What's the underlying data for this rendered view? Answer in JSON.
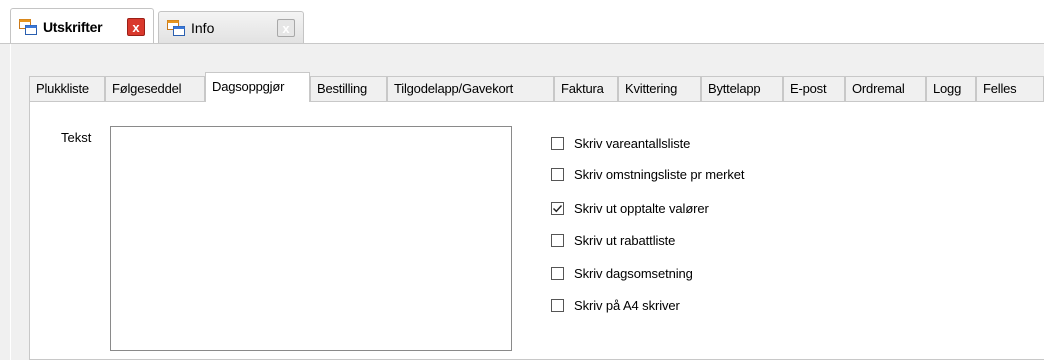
{
  "doc_tabs": [
    {
      "label": "Utskrifter",
      "active": true,
      "close": "x"
    },
    {
      "label": "Info",
      "active": false,
      "close": "x"
    }
  ],
  "tabs": [
    {
      "label": "Plukkliste",
      "active": false
    },
    {
      "label": "Følgeseddel",
      "active": false
    },
    {
      "label": "Dagsoppgjør",
      "active": true
    },
    {
      "label": "Bestilling",
      "active": false
    },
    {
      "label": "Tilgodelapp/Gavekort",
      "active": false
    },
    {
      "label": "Faktura",
      "active": false
    },
    {
      "label": "Kvittering",
      "active": false
    },
    {
      "label": "Byttelapp",
      "active": false
    },
    {
      "label": "E-post",
      "active": false
    },
    {
      "label": "Ordremal",
      "active": false
    },
    {
      "label": "Logg",
      "active": false
    },
    {
      "label": "Felles",
      "active": false
    }
  ],
  "form": {
    "tekst_label": "Tekst",
    "tekst_value": ""
  },
  "checkboxes": [
    {
      "label": "Skriv vareantallsliste",
      "checked": false
    },
    {
      "label": "Skriv omstningsliste pr merket",
      "checked": false
    },
    {
      "label": "Skriv ut opptalte valører",
      "checked": true
    },
    {
      "label": "Skriv ut rabattliste",
      "checked": false
    },
    {
      "label": "Skriv dagsomsetning",
      "checked": false
    },
    {
      "label": "Skriv på A4 skriver",
      "checked": false
    }
  ],
  "icons": {
    "app_icon": "window-app-icon",
    "close_icon": "close-icon",
    "check_icon": "checkmark-icon"
  },
  "colors": {
    "close_active": "#d9382c",
    "close_inactive": "#e6e6e6",
    "background": "#f0f0f0"
  }
}
